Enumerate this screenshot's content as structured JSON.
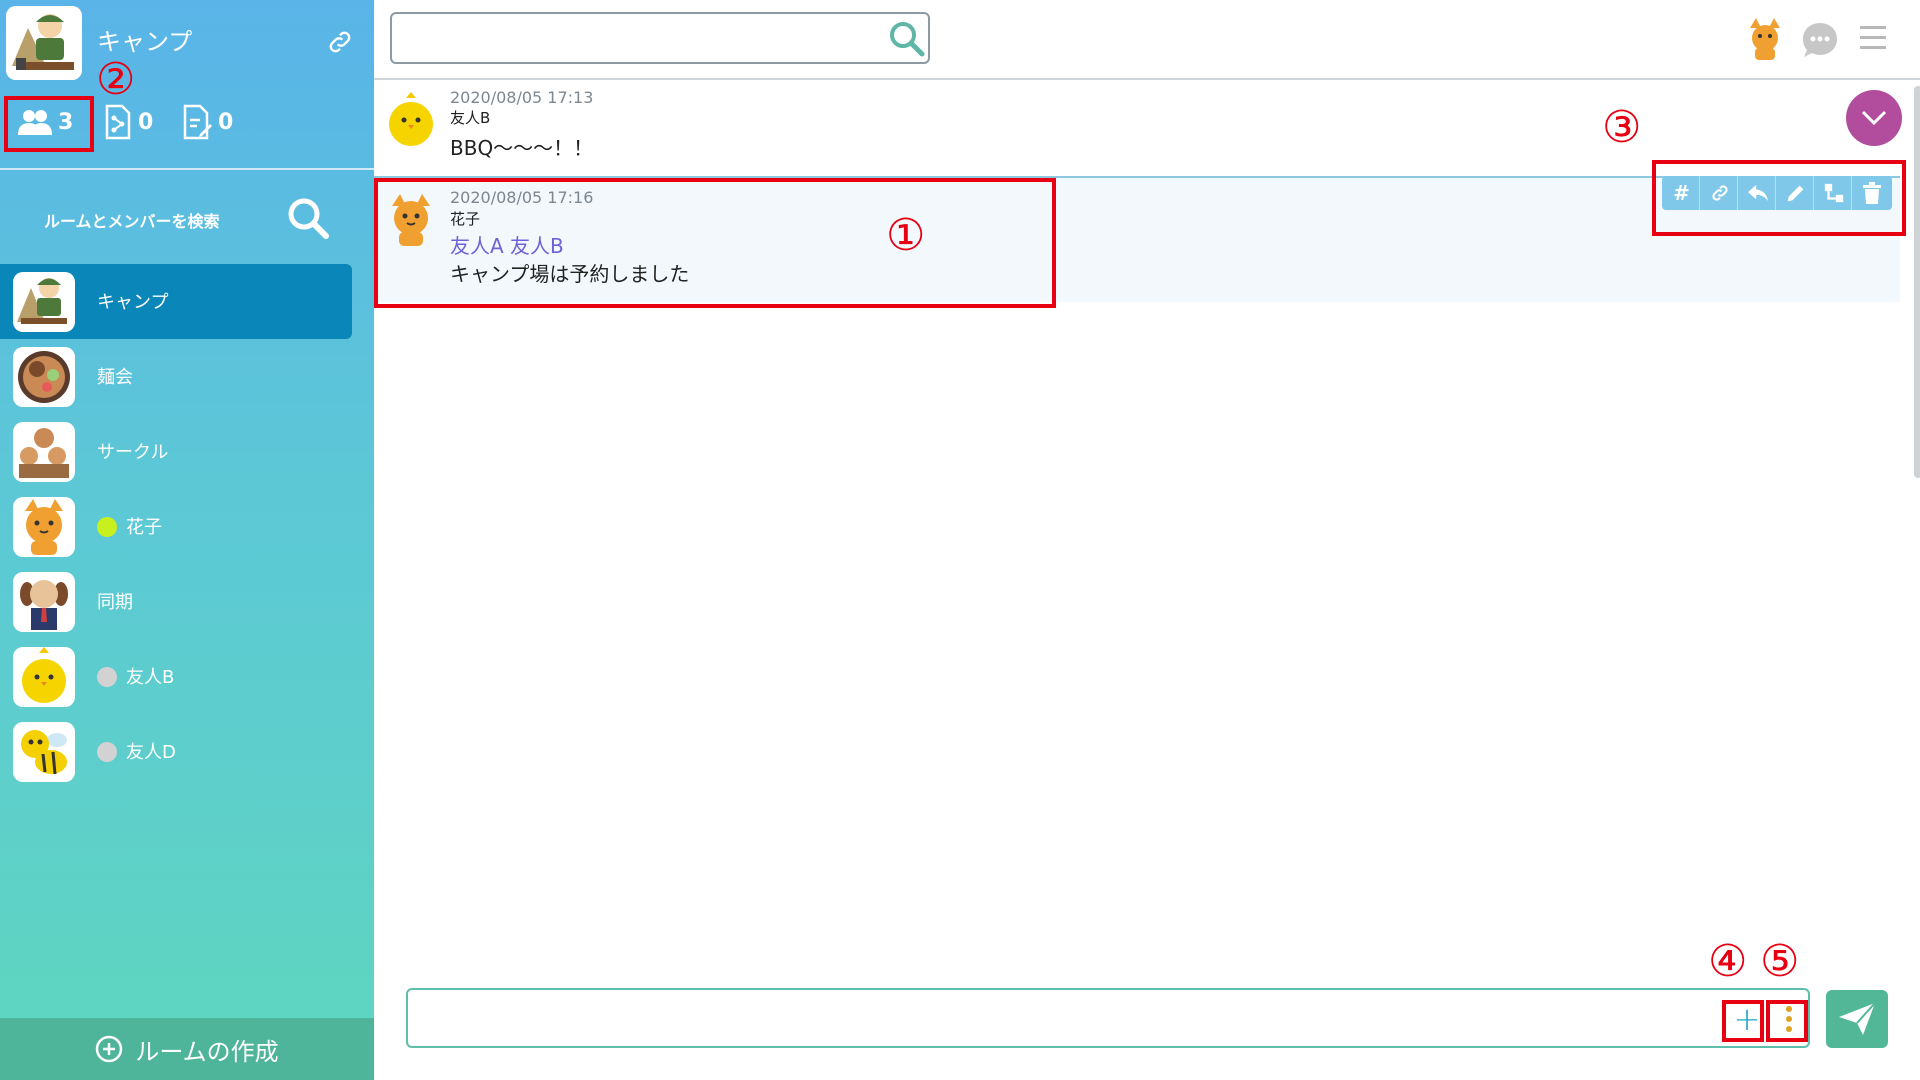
{
  "sidebar": {
    "room_title": "キャンプ",
    "stats": {
      "members": "3",
      "files": "0",
      "notes": "0"
    },
    "search_label": "ルームとメンバーを検索",
    "rooms": [
      {
        "label": "キャンプ",
        "active": true
      },
      {
        "label": "麺会"
      },
      {
        "label": "サークル"
      },
      {
        "label": "花子",
        "status": "online",
        "status_color": "#c8f01e"
      },
      {
        "label": "同期"
      },
      {
        "label": "友人B",
        "status": "offline",
        "status_color": "#d2d2d2"
      },
      {
        "label": "友人D",
        "status": "offline",
        "status_color": "#d2d2d2"
      }
    ],
    "create_room_label": "ルームの作成"
  },
  "topbar": {
    "search_value": "",
    "search_placeholder": ""
  },
  "messages": [
    {
      "time": "2020/08/05 17:13",
      "author": "友人B",
      "text": "BBQ～～～！！"
    },
    {
      "time": "2020/08/05 17:16",
      "author": "花子",
      "mentions": "友人A 友人B",
      "text": "キャンプ場は予約しました"
    }
  ],
  "message_toolbar": {
    "hash_label": "#"
  },
  "composer": {
    "value": "",
    "placeholder": "",
    "attach_label": "+"
  },
  "annotations": {
    "n1": "①",
    "n2": "②",
    "n3": "③",
    "n4": "④",
    "n5": "⑤"
  },
  "colors": {
    "annotation": "#e60012",
    "active_room": "#0a86b8",
    "mention": "#6b63d6",
    "scroll_down": "#b14d9c",
    "send": "#52b797"
  }
}
